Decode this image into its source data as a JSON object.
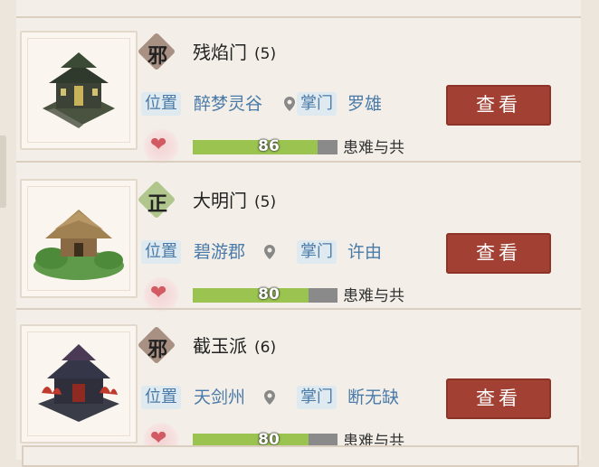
{
  "sects": [
    {
      "alignment": "邪",
      "name": "残焰门",
      "count": "(5)",
      "location_label": "位置",
      "location": "醉梦灵谷",
      "leader_label": "掌门",
      "leader": "罗雄",
      "affinity": 86,
      "affinity_text": "86",
      "relation": "患难与共",
      "button": "查看",
      "icon": "dark-pagoda-building"
    },
    {
      "alignment": "正",
      "name": "大明门",
      "count": "(5)",
      "location_label": "位置",
      "location": "碧游郡",
      "leader_label": "掌门",
      "leader": "许由",
      "affinity": 80,
      "affinity_text": "80",
      "relation": "患难与共",
      "button": "查看",
      "icon": "straw-roof-hall"
    },
    {
      "alignment": "邪",
      "name": "截玉派",
      "count": "(6)",
      "location_label": "位置",
      "location": "天剑州",
      "leader_label": "掌门",
      "leader": "断无缺",
      "affinity": 80,
      "affinity_text": "80",
      "relation": "患难与共",
      "button": "查看",
      "icon": "dark-fortress-red-flames"
    }
  ],
  "colors": {
    "evil_badge": "#a89083",
    "good_badge": "#b0c68d",
    "button": "#a24034",
    "tag_text": "#4a7aa8",
    "bar_fill": "#9ac34f"
  }
}
